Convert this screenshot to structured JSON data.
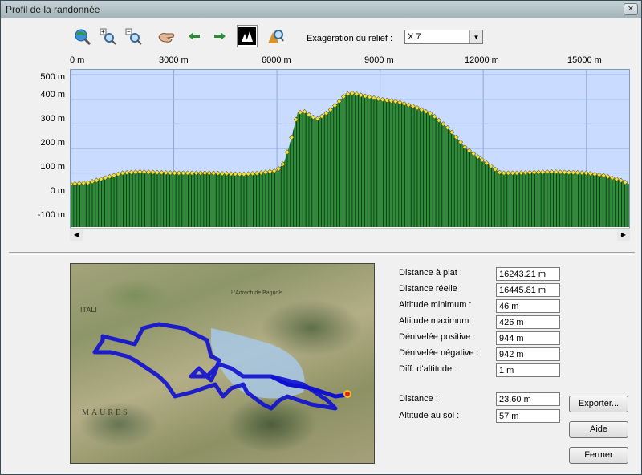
{
  "window": {
    "title": "Profil de la randonnée",
    "close_label": "✕"
  },
  "toolbar": {
    "relief_label": "Exagération du relief :",
    "relief_value": "X 7",
    "icons": [
      "globe-search-icon",
      "zoom-in-icon",
      "zoom-out-icon",
      "hand-pan-icon",
      "arrow-left-icon",
      "arrow-right-icon",
      "forest-view-icon",
      "profile-search-icon"
    ]
  },
  "chart_data": {
    "type": "area",
    "x_ticks": [
      "0 m",
      "3000 m",
      "6000 m",
      "9000 m",
      "12000 m",
      "15000 m"
    ],
    "y_ticks": [
      "500 m",
      "400 m",
      "300 m",
      "200 m",
      "100 m",
      "0 m",
      "-100 m"
    ],
    "xlim": [
      0,
      16243
    ],
    "ylim": [
      -120,
      520
    ],
    "x": [
      0,
      500,
      1000,
      1500,
      2000,
      3000,
      4000,
      5000,
      5500,
      6000,
      6200,
      6400,
      6600,
      6800,
      7000,
      7200,
      7500,
      7800,
      8000,
      8200,
      8500,
      9000,
      9500,
      10000,
      10500,
      11000,
      11500,
      12000,
      12500,
      13000,
      14000,
      15000,
      15500,
      16000,
      16243
    ],
    "y": [
      55,
      60,
      80,
      100,
      105,
      100,
      100,
      95,
      100,
      110,
      140,
      230,
      345,
      350,
      330,
      320,
      350,
      390,
      420,
      425,
      415,
      400,
      390,
      370,
      340,
      280,
      200,
      150,
      100,
      100,
      105,
      100,
      90,
      70,
      55
    ],
    "fill_color": "#2e8b3a",
    "point_color": "#f0e040",
    "background": "#c9dcff"
  },
  "stats": [
    {
      "label": "Distance à plat :",
      "value": "16243.21 m"
    },
    {
      "label": "Distance réelle :",
      "value": "16445.81 m"
    },
    {
      "label": "Altitude minimum :",
      "value": "46 m"
    },
    {
      "label": "Altitude maximum :",
      "value": "426 m"
    },
    {
      "label": "Dénivelée positive :",
      "value": "944 m"
    },
    {
      "label": "Dénivelée négative :",
      "value": "942 m"
    },
    {
      "label": "Diff. d'altitude :",
      "value": "1 m"
    }
  ],
  "cursor": {
    "distance_label": "Distance :",
    "distance_value": "23.60 m",
    "altitude_label": "Altitude au sol :",
    "altitude_value": "57 m"
  },
  "buttons": {
    "export": "Exporter...",
    "help": "Aide",
    "close": "Fermer"
  },
  "map": {
    "labels": [
      "ITALI",
      "MAURES",
      "L'Adrech de Bagnols"
    ]
  }
}
